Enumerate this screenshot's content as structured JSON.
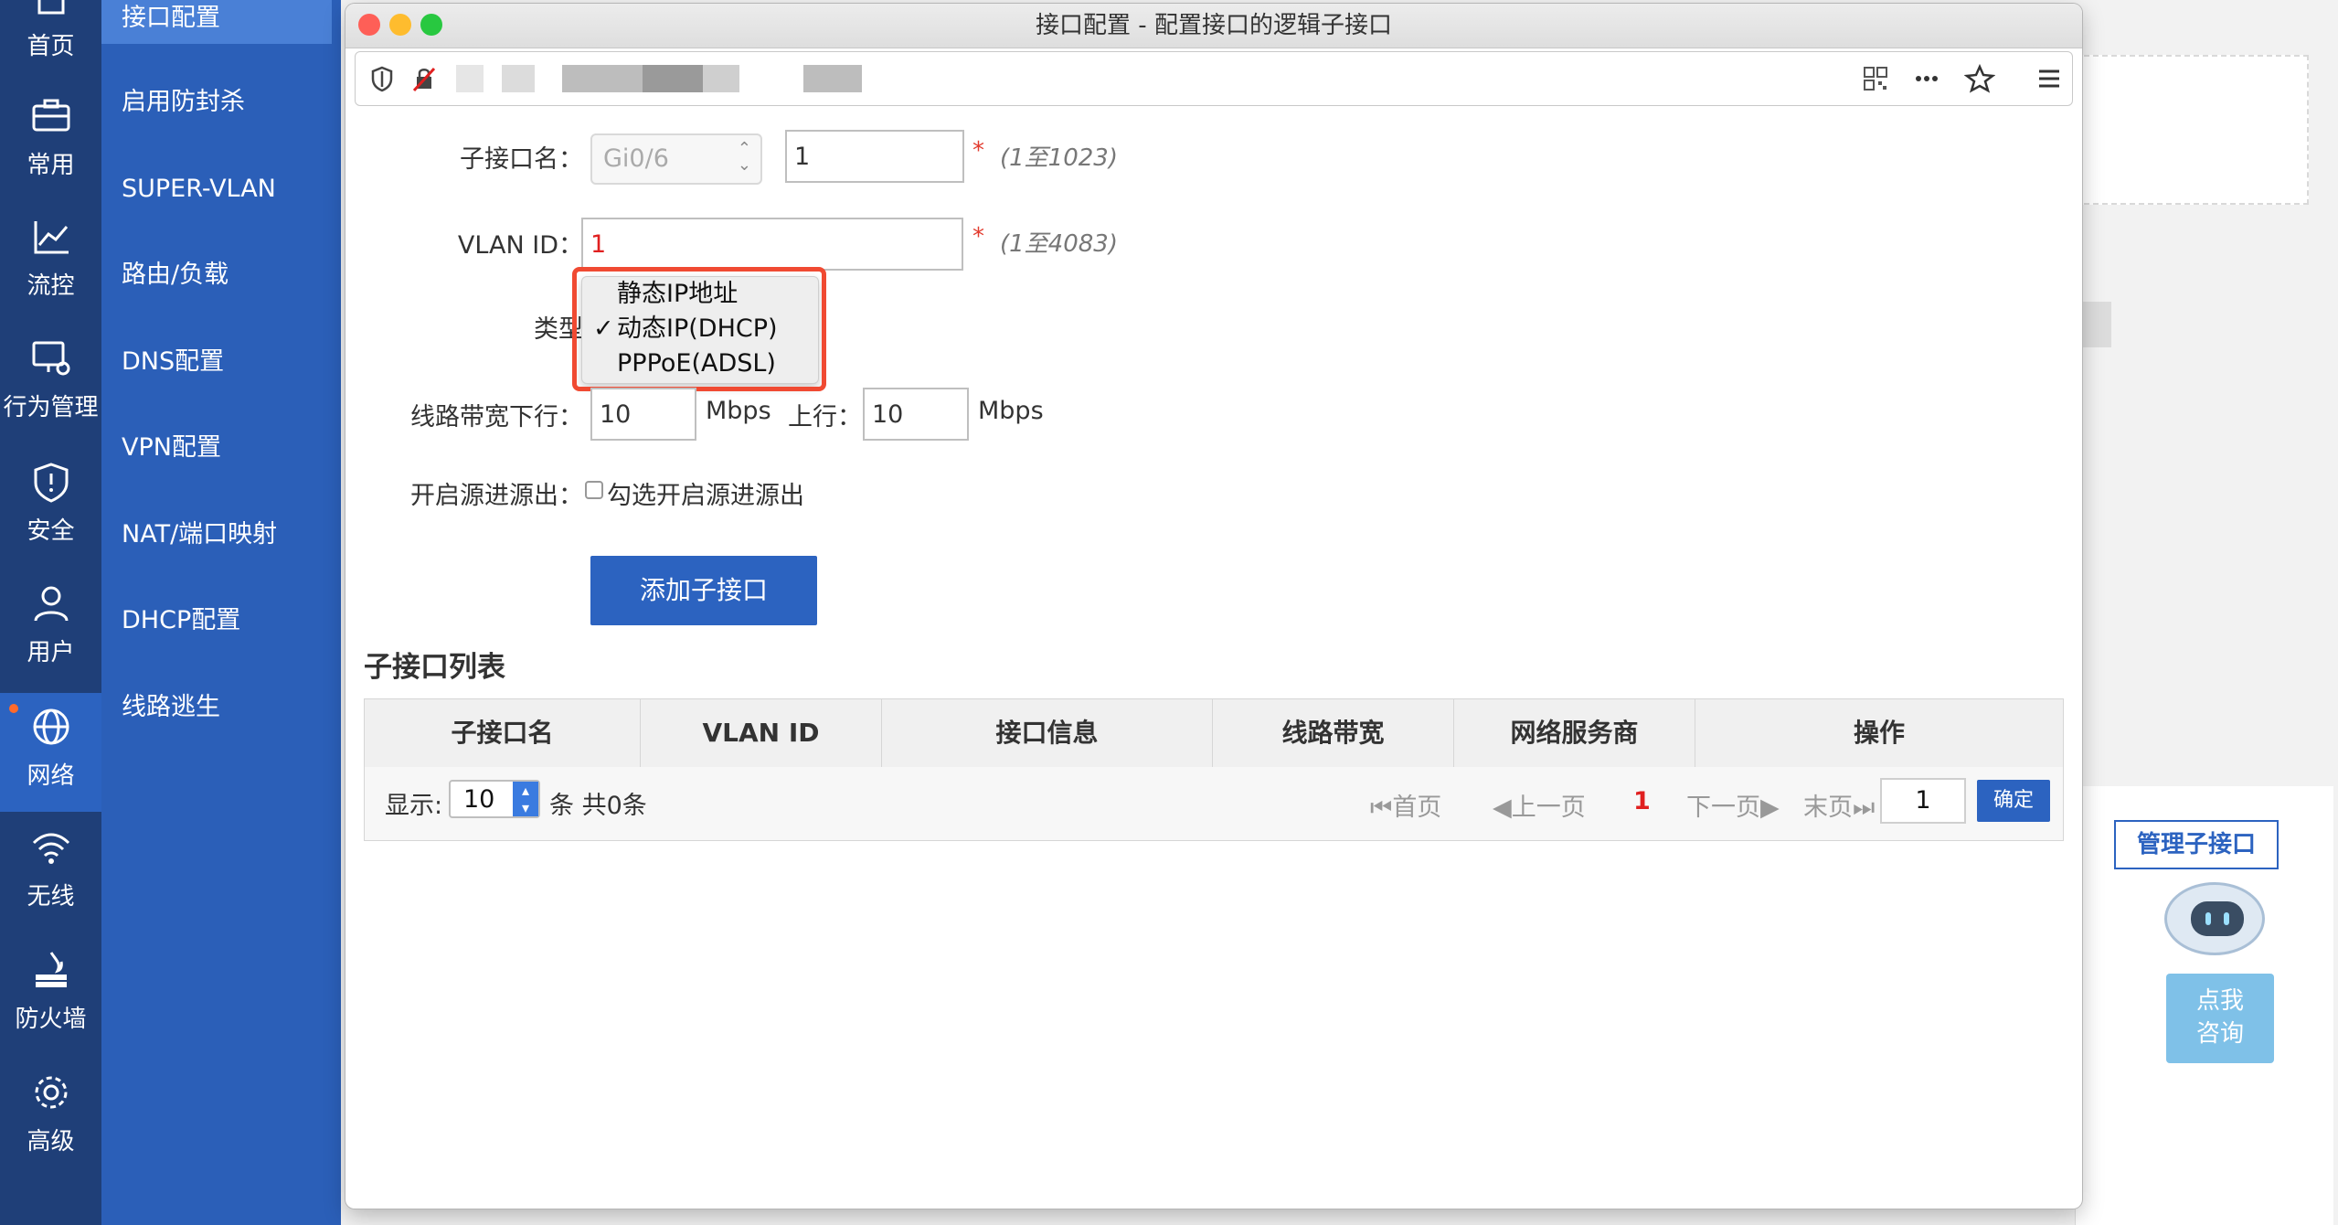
{
  "rail": [
    {
      "label": "首页",
      "icon": "home-icon"
    },
    {
      "label": "常用",
      "icon": "briefcase-icon"
    },
    {
      "label": "流控",
      "icon": "chart-line-icon"
    },
    {
      "label": "行为管理",
      "icon": "monitor-gear-icon"
    },
    {
      "label": "安全",
      "icon": "shield-icon"
    },
    {
      "label": "用户",
      "icon": "user-icon"
    },
    {
      "label": "网络",
      "icon": "globe-icon",
      "active": true
    },
    {
      "label": "无线",
      "icon": "wifi-icon"
    },
    {
      "label": "防火墙",
      "icon": "firewall-icon"
    },
    {
      "label": "高级",
      "icon": "gear-icon"
    }
  ],
  "submenu": [
    "接口配置",
    "启用防封杀",
    "SUPER-VLAN",
    "路由/负载",
    "DNS配置",
    "VPN配置",
    "NAT/端口映射",
    "DHCP配置",
    "线路逃生"
  ],
  "window": {
    "title": "接口配置 - 配置接口的逻辑子接口"
  },
  "form": {
    "subif_label": "子接口名：",
    "subif_select": "Gi0/6",
    "subif_value": "1",
    "subif_hint": "(1至1023)",
    "vlan_label": "VLAN ID：",
    "vlan_value": "1",
    "vlan_hint": "(1至4083)",
    "star": "*",
    "type_label": "类型",
    "type_options": [
      "静态IP地址",
      "动态IP(DHCP)",
      "PPPoE(ADSL)"
    ],
    "check_mark": "✓",
    "bw_label": "线路带宽下行：",
    "bw_down": "10",
    "bw_unit": "Mbps",
    "bw_up_label": "上行：",
    "bw_up": "10",
    "src_label": "开启源进源出：",
    "src_checkbox_label": "勾选开启源进源出",
    "add_button": "添加子接口"
  },
  "list": {
    "title": "子接口列表",
    "columns": [
      "子接口名",
      "VLAN ID",
      "接口信息",
      "线路带宽",
      "网络服务商",
      "操作"
    ],
    "show_label": "显示:",
    "page_size": "10",
    "count_label": "条 共0条",
    "first": "首页",
    "prev": "上一页",
    "current_page": "1",
    "next": "下一页",
    "last": "末页",
    "page_input": "1",
    "confirm": "确定"
  },
  "background": {
    "manage_button": "管理子接口",
    "consult_line1": "点我",
    "consult_line2": "咨询"
  },
  "colors": {
    "rail": "#1f3f78",
    "submenu": "#2b5fb8",
    "accent": "#2c63c0",
    "highlight": "#f04a32"
  }
}
